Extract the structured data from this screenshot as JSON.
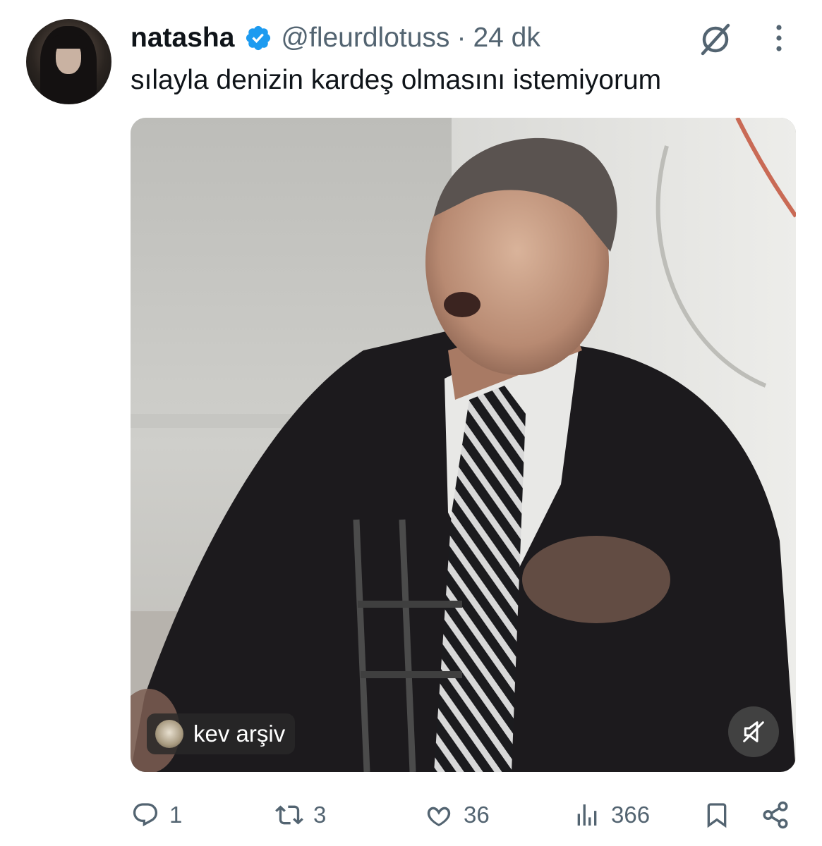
{
  "tweet": {
    "author_name": "natasha",
    "handle": "@fleurdlotuss",
    "separator": "·",
    "time": "24 dk",
    "text": "sılayla denizin kardeş olmasını istemiyorum",
    "media": {
      "source_label": "kev arşiv",
      "muted": true
    }
  },
  "actions": {
    "replies": "1",
    "reposts": "3",
    "likes": "36",
    "views": "366"
  },
  "icons": {
    "verified": "verified-badge-icon",
    "grok": "grok-icon",
    "more": "more-vertical-icon",
    "reply": "reply-icon",
    "repost": "repost-icon",
    "like": "heart-icon",
    "views": "views-chart-icon",
    "bookmark": "bookmark-icon",
    "share": "share-icon",
    "mute": "mute-icon"
  },
  "colors": {
    "verified": "#1d9bf0",
    "text": "#0f1419",
    "secondary": "#536471"
  }
}
